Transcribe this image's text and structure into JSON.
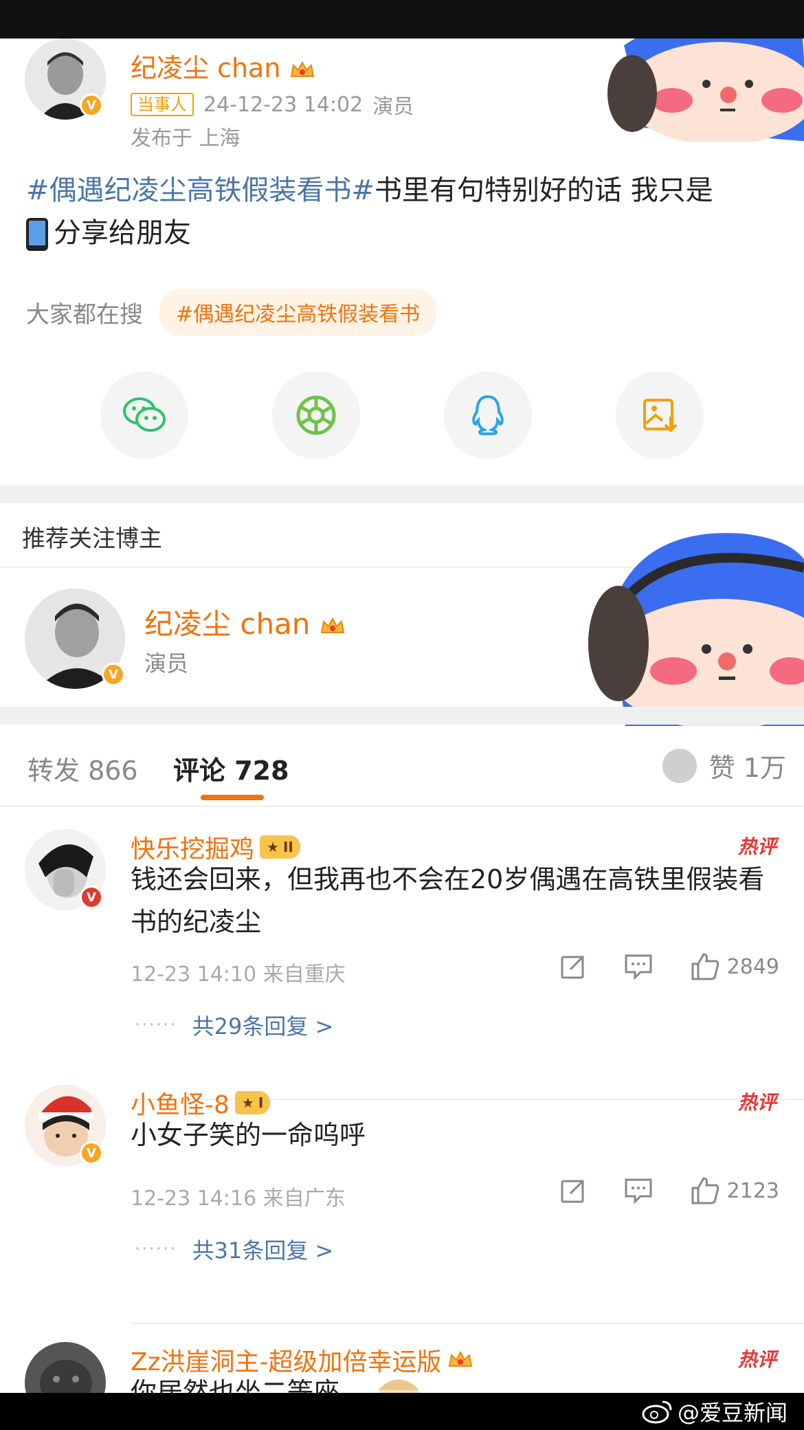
{
  "post": {
    "author": "纪凌尘 chan",
    "party_tag": "当事人",
    "datetime": "24-12-23 14:02",
    "role": "演员",
    "location": "发布于 上海",
    "hashtag": "#偶遇纪凌尘高铁假装看书#",
    "text_line1": "书里有句特别好的话  我只是",
    "text_line2": "分享给朋友",
    "search_label": "大家都在搜",
    "search_chip": "#偶遇纪凌尘高铁假装看书"
  },
  "share_icons": [
    "wechat-icon",
    "moments-icon",
    "qq-icon",
    "save-image-icon"
  ],
  "recommend": {
    "title": "推荐关注博主",
    "name": "纪凌尘 chan",
    "role": "演员"
  },
  "tabs": {
    "repost": "转发 866",
    "comment": "评论 728",
    "like": "赞 1万"
  },
  "comments": [
    {
      "name": "快乐挖掘鸡",
      "level": "II",
      "hot": "热评",
      "text": "钱还会回来，但我再也不会在20岁偶遇在高铁里假装看书的纪凌尘",
      "meta": "12-23 14:10  来自重庆",
      "likes": "2849",
      "replies": "共29条回复 >"
    },
    {
      "name": "小鱼怪-8",
      "level": "I",
      "hot": "热评",
      "text": "小女子笑的一命呜呼",
      "meta": "12-23 14:16  来自广东",
      "likes": "2123",
      "replies": "共31条回复 >"
    },
    {
      "name": "Zz洪崖洞主-超级加倍幸运版",
      "hot": "热评",
      "text": "你居然也坐二等座"
    }
  ],
  "watermark": "@爱豆新闻",
  "colors": {
    "accent": "#f2720c",
    "topic_blue": "#4a76a8",
    "hot_red": "#e33333"
  }
}
